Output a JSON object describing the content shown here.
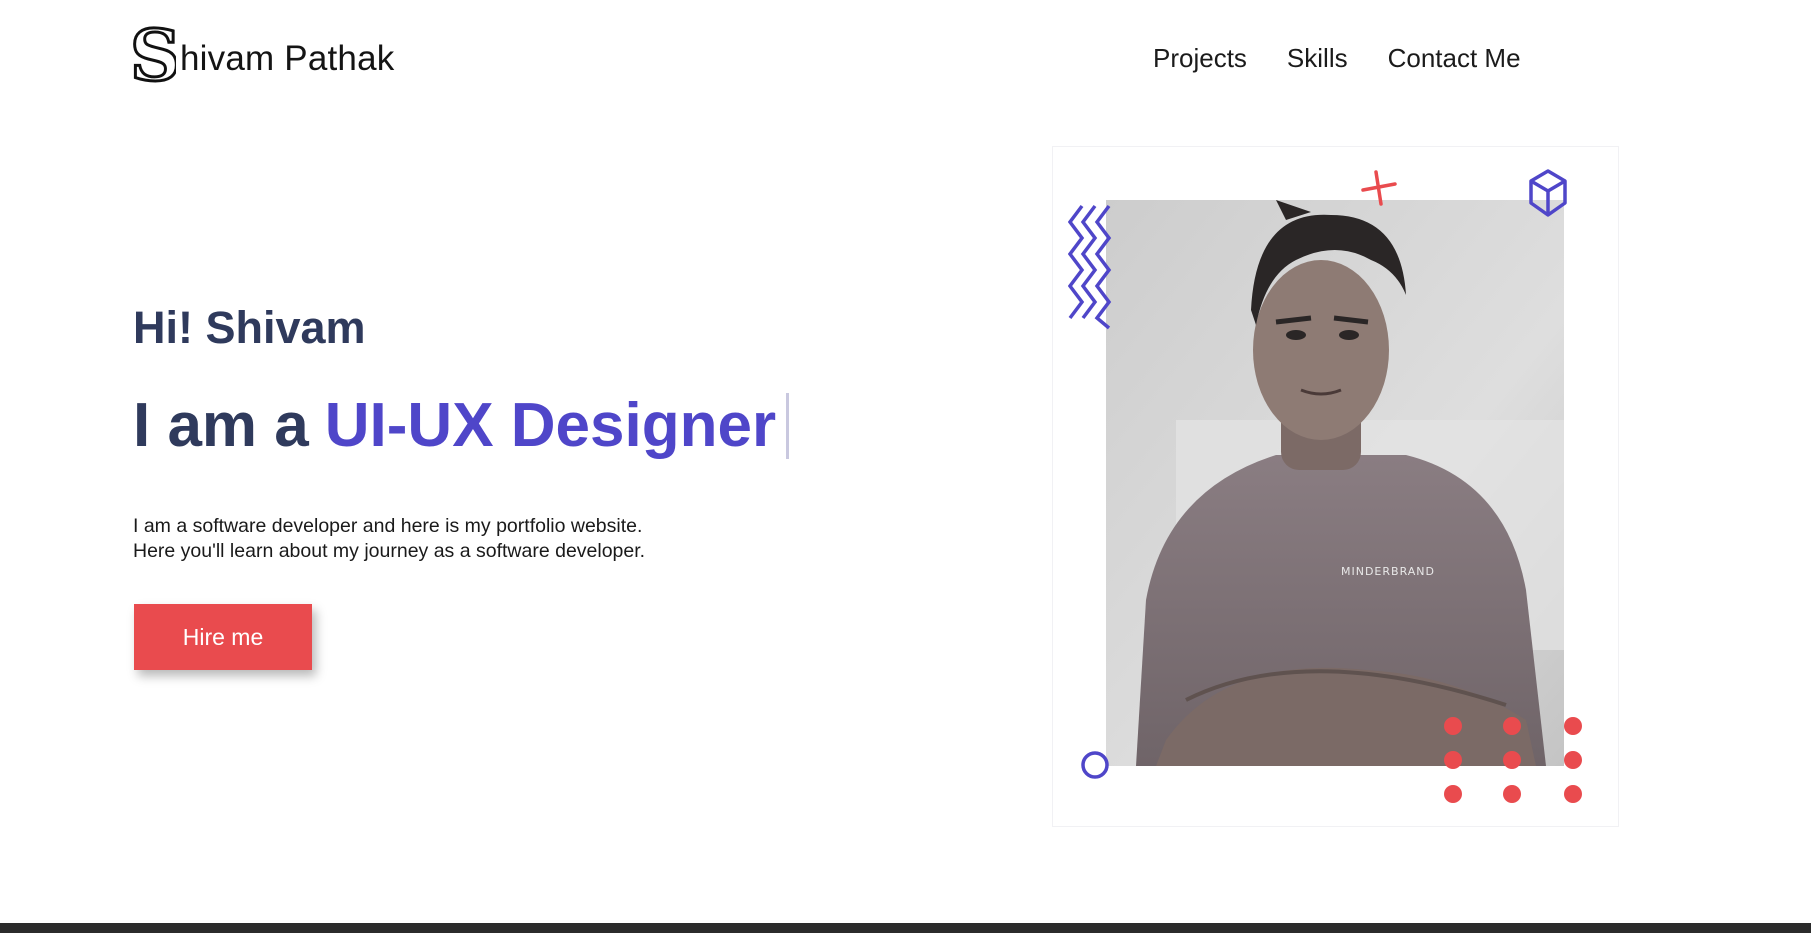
{
  "brand": {
    "logo_letter": "S",
    "name_rest": "hivam Pathak"
  },
  "nav": {
    "links": [
      "Projects",
      "Skills",
      "Contact Me"
    ]
  },
  "hero": {
    "greeting": "Hi! Shivam",
    "headline_prefix": "I am a",
    "headline_role": "UI-UX Designer",
    "description_line1": "I am a software developer and here is my portfolio website.",
    "description_line2": "Here you'll learn about my journey as a software developer.",
    "cta_label": "Hire me"
  },
  "portrait": {
    "shirt_print": "MINDERBRAND"
  },
  "colors": {
    "accent": "#4f46c9",
    "cta": "#e94b4e",
    "heading": "#2f3a5c",
    "taskbar": "#2b2b2b"
  },
  "icons": [
    "logo-s-icon",
    "zigzag-icon",
    "plus-icon",
    "cube-icon",
    "ring-icon",
    "dot-grid-icon",
    "text-cursor-icon"
  ]
}
